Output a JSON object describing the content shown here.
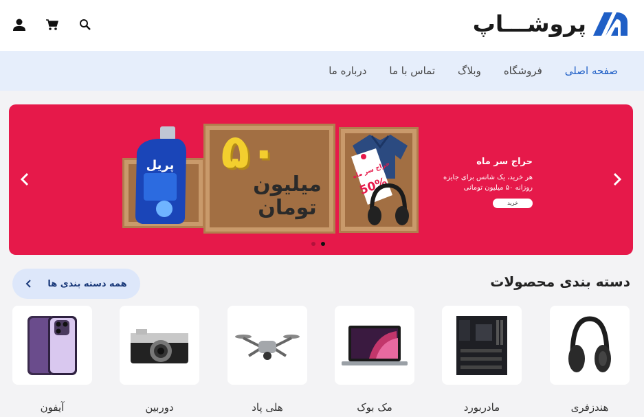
{
  "brand": {
    "name": "پروشـــاپ",
    "accent": "#1f5fc6"
  },
  "header": {
    "icons": [
      "user-icon",
      "cart-icon",
      "search-icon"
    ]
  },
  "nav": {
    "items": [
      {
        "label": "صفحه اصلی",
        "active": true
      },
      {
        "label": "فروشگاه"
      },
      {
        "label": "وبلاگ"
      },
      {
        "label": "تماس با ما"
      },
      {
        "label": "درباره ما"
      }
    ]
  },
  "banner": {
    "bg_color": "#e6194a",
    "title": "حراج سر ماه",
    "text_line1": "هر خرید، یک شانس برای جایزه",
    "text_line2": "روزانه ۵۰ میلیون تومانی",
    "button": "خرید",
    "big_number": "۵۰",
    "big_text1": "میلیون",
    "big_text2": "تومان",
    "tag_title": "حراج سر ماه",
    "tag_percent": "50%",
    "bottle_label": "پریل",
    "slides": 2,
    "active_slide": 2
  },
  "section": {
    "title": "دسته بندی محصولات",
    "all_button": "همه دسته بندی ها"
  },
  "categories": [
    {
      "label": "هندزفری",
      "icon": "headphones-icon"
    },
    {
      "label": "مادربورد",
      "icon": "motherboard-icon"
    },
    {
      "label": "مک بوک",
      "icon": "laptop-icon"
    },
    {
      "label": "هلی پاد",
      "icon": "drone-icon"
    },
    {
      "label": "دوربین",
      "icon": "camera-icon"
    },
    {
      "label": "آیفون",
      "icon": "phone-icon"
    }
  ]
}
